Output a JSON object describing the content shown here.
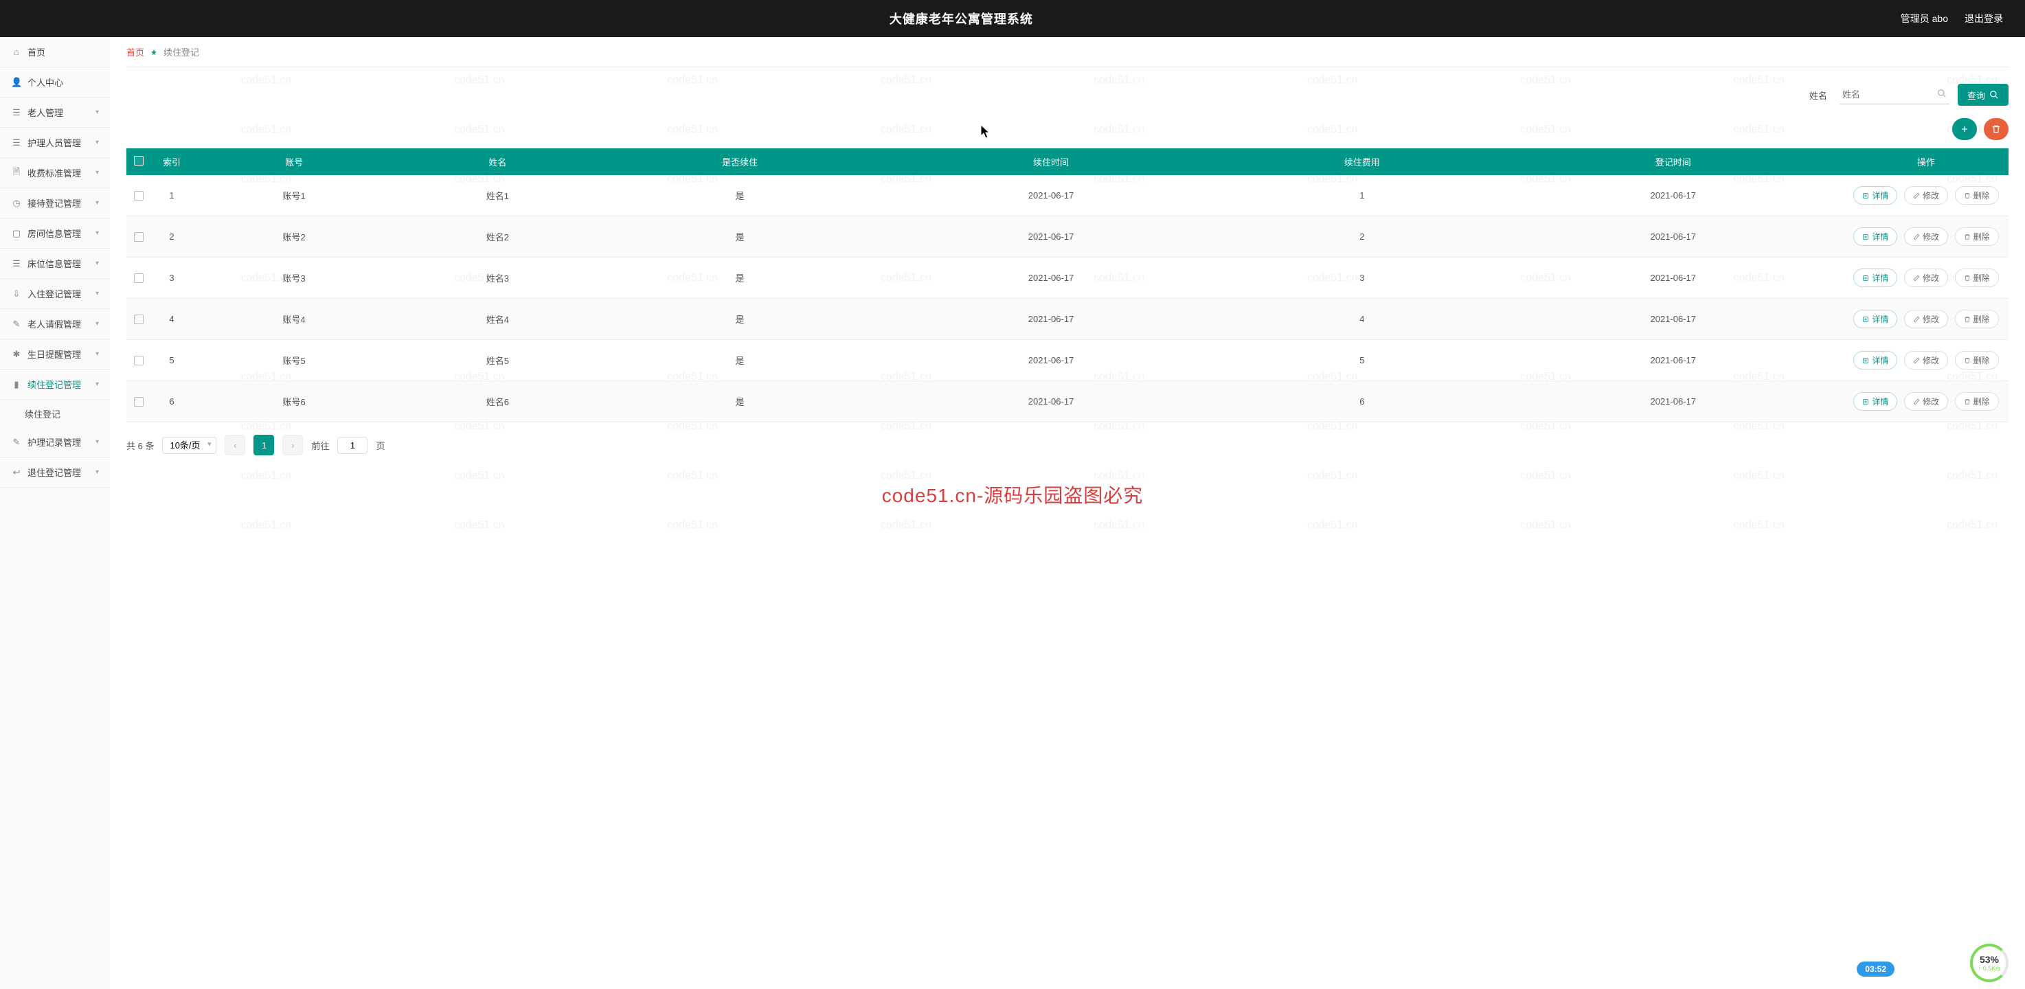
{
  "header": {
    "title": "大健康老年公寓管理系统",
    "admin_label": "管理员 abo",
    "logout_label": "退出登录"
  },
  "sidebar": {
    "items": [
      {
        "icon": "home",
        "label": "首页",
        "caret": false
      },
      {
        "icon": "user",
        "label": "个人中心",
        "caret": false
      },
      {
        "icon": "list",
        "label": "老人管理",
        "caret": true
      },
      {
        "icon": "list",
        "label": "护理人员管理",
        "caret": true
      },
      {
        "icon": "doc",
        "label": "收费标准管理",
        "caret": true
      },
      {
        "icon": "clock",
        "label": "接待登记管理",
        "caret": true
      },
      {
        "icon": "room",
        "label": "房间信息管理",
        "caret": true
      },
      {
        "icon": "bed",
        "label": "床位信息管理",
        "caret": true
      },
      {
        "icon": "login",
        "label": "入住登记管理",
        "caret": true
      },
      {
        "icon": "leave",
        "label": "老人请假管理",
        "caret": true
      },
      {
        "icon": "gift",
        "label": "生日提醒管理",
        "caret": true
      },
      {
        "icon": "chart",
        "label": "续住登记管理",
        "caret": true,
        "active": true,
        "sub": [
          {
            "label": "续住登记"
          }
        ]
      },
      {
        "icon": "log",
        "label": "护理记录管理",
        "caret": true
      },
      {
        "icon": "out",
        "label": "退住登记管理",
        "caret": true
      }
    ]
  },
  "breadcrumb": {
    "home": "首页",
    "current": "续住登记"
  },
  "search": {
    "label": "姓名",
    "placeholder": "姓名",
    "button": "查询"
  },
  "table": {
    "headers": {
      "index": "索引",
      "account": "账号",
      "name": "姓名",
      "renew": "是否续住",
      "renew_time": "续住时间",
      "renew_fee": "续住费用",
      "reg_time": "登记时间",
      "ops": "操作"
    },
    "rows": [
      {
        "idx": "1",
        "account": "账号1",
        "name": "姓名1",
        "renew": "是",
        "renew_time": "2021-06-17",
        "fee": "1",
        "reg_time": "2021-06-17"
      },
      {
        "idx": "2",
        "account": "账号2",
        "name": "姓名2",
        "renew": "是",
        "renew_time": "2021-06-17",
        "fee": "2",
        "reg_time": "2021-06-17"
      },
      {
        "idx": "3",
        "account": "账号3",
        "name": "姓名3",
        "renew": "是",
        "renew_time": "2021-06-17",
        "fee": "3",
        "reg_time": "2021-06-17"
      },
      {
        "idx": "4",
        "account": "账号4",
        "name": "姓名4",
        "renew": "是",
        "renew_time": "2021-06-17",
        "fee": "4",
        "reg_time": "2021-06-17"
      },
      {
        "idx": "5",
        "account": "账号5",
        "name": "姓名5",
        "renew": "是",
        "renew_time": "2021-06-17",
        "fee": "5",
        "reg_time": "2021-06-17"
      },
      {
        "idx": "6",
        "account": "账号6",
        "name": "姓名6",
        "renew": "是",
        "renew_time": "2021-06-17",
        "fee": "6",
        "reg_time": "2021-06-17"
      }
    ],
    "actions": {
      "detail": "详情",
      "edit": "修改",
      "delete": "删除"
    }
  },
  "pagination": {
    "total_text": "共 6 条",
    "per_page": "10条/页",
    "current": "1",
    "goto_prefix": "前往",
    "goto_value": "1",
    "goto_suffix": "页"
  },
  "overlay": {
    "watermark_center": "code51.cn-源码乐园盗图必究",
    "watermark_tile": "code51.cn",
    "time_badge": "03:52",
    "perf_pct": "53%",
    "perf_rate": "↑ 0.5K/s"
  }
}
